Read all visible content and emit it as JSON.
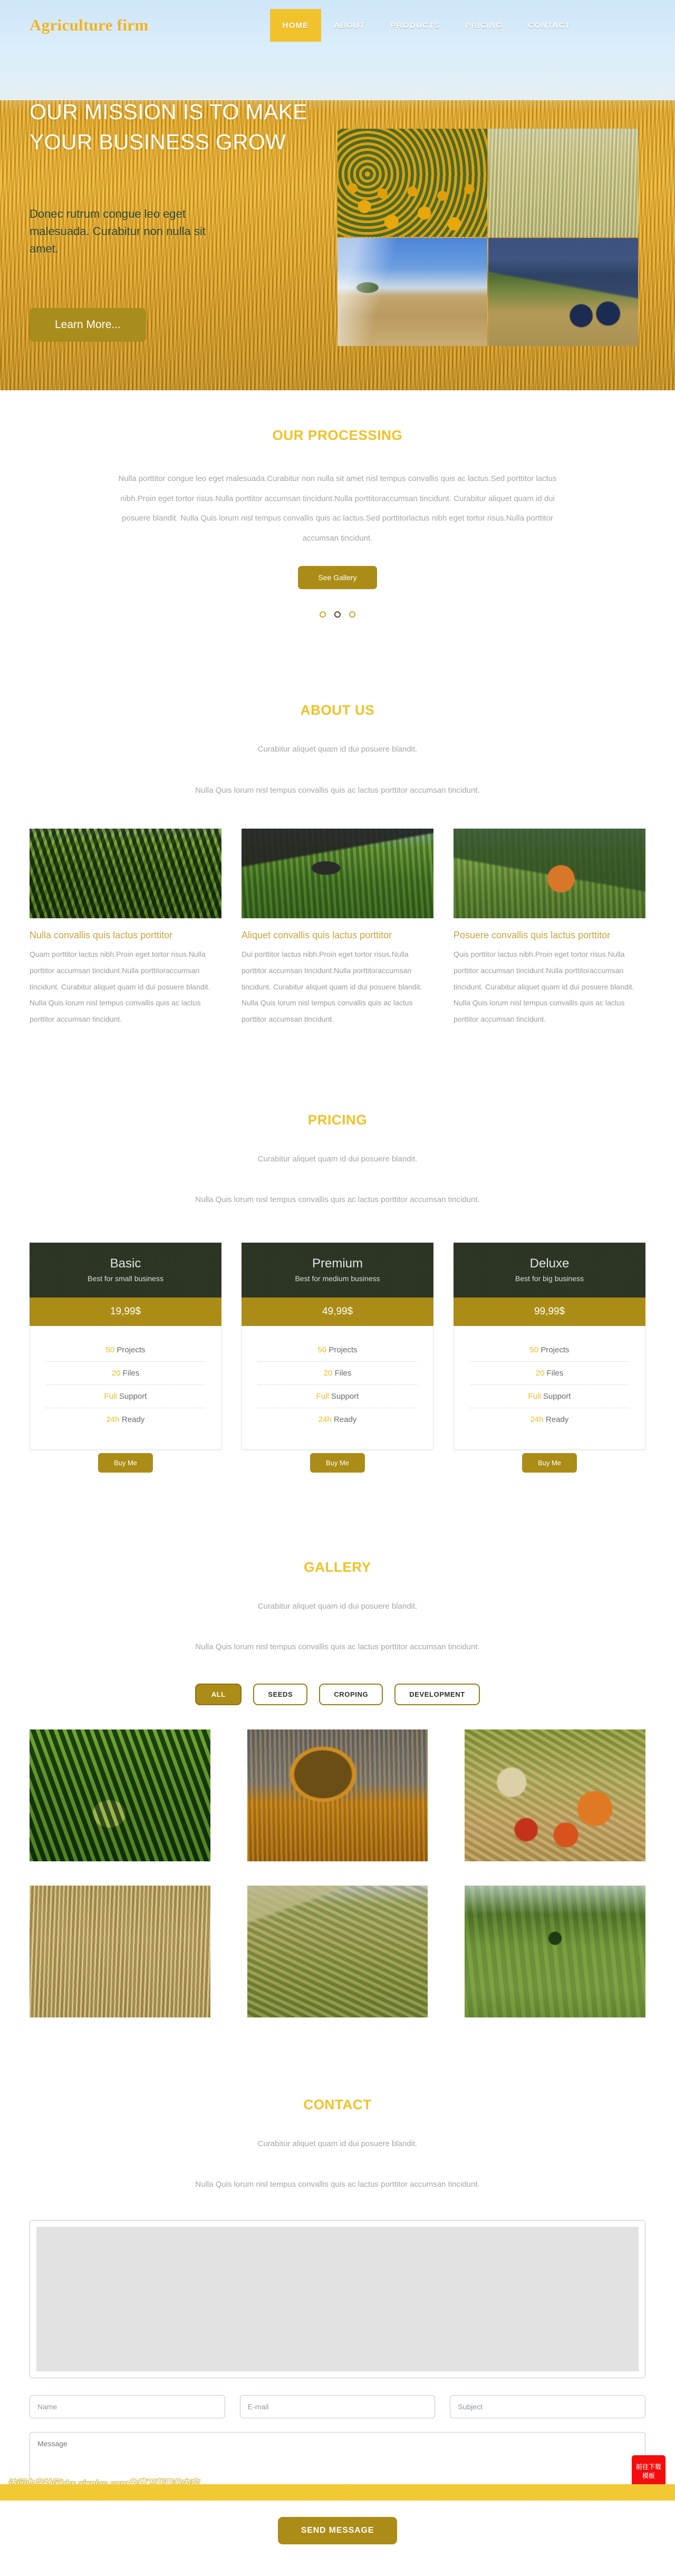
{
  "header": {
    "brand": "Agriculture firm",
    "nav": [
      {
        "label": "HOME",
        "active": true
      },
      {
        "label": "ABOUT",
        "active": false
      },
      {
        "label": "PRODUCTS",
        "active": false
      },
      {
        "label": "PRICING",
        "active": false
      },
      {
        "label": "CONTACT",
        "active": false
      }
    ]
  },
  "hero": {
    "title": "OUR MISSION IS TO MAKE YOUR BUSINESS GROW",
    "subtitle": "Donec rutrum congue leo eget malesuada. Curabitur non nulla sit amet.",
    "cta": "Learn More...",
    "collage": [
      "sunflower-field-photo",
      "wheat-closeup-photo",
      "harvester-field-photo",
      "tractor-trailer-photo"
    ]
  },
  "processing": {
    "title": "OUR PROCESSING",
    "lead": "Nulla porttitor congue leo eget malesuada.Curabitur non nulla sit amet nisl tempus convallis quis ac lactus.Sed porttitor lactus nibh.Proin eget tortor risus.Nulla porttitor accumsan tincidunt.Nulla porttitoraccumsan tincidunt. Curabitur aliquet quam id dui posuere blandit. Nulla Quis lorum nisl tempus convallis quis ac lactus.Sed porttitorlactus nibh eget tortor risus.Nulla porttitor accumsan tincidunt.",
    "button": "See Gallery",
    "dots": 3,
    "active_dot": 1
  },
  "about": {
    "title": "ABOUT US",
    "lead_line1": "Curabitur aliquet quam id dui posuere blandit.",
    "lead_line2": "Nulla Quis lorum nisl tempus convallis quis ac lactus porttitor accumsan tincidunt.",
    "cards": [
      {
        "image": "corn-field-photo",
        "title": "Nulla convallis quis lactus porttitor",
        "body": "Quam porttitor lactus nibh.Proin eget tortor risus.Nulla porttitor accumsan tincidunt.Nulla porttitoraccumsan tincidunt. Curabitur aliquet quam id dui posuere blandit. Nulla Quis lorum nisl tempus convallis quis ac lactus porttitor accumsan tincidunt."
      },
      {
        "image": "farmer-in-field-photo",
        "title": "Aliquet convallis quis lactus porttitor",
        "body": "Dui porttitor lactus nibh.Proin eget tortor risus.Nulla porttitor accumsan tincidunt.Nulla porttitoraccumsan tincidunt. Curabitur aliquet quam id dui posuere blandit. Nulla Quis lorum nisl tempus convallis quis ac lactus porttitor accumsan tincidunt."
      },
      {
        "image": "tractor-baling-photo",
        "title": "Posuere convallis quis lactus porttitor",
        "body": "Quis porttitor lactus nibh.Proin eget tortor risus.Nulla porttitor accumsan tincidunt.Nulla porttitoraccumsan tincidunt. Curabitur aliquet quam id dui posuere blandit. Nulla Quis lorum nisl tempus convallis quis ac lactus porttitor accumsan tincidunt."
      }
    ]
  },
  "pricing": {
    "title": "PRICING",
    "lead_line1": "Curabitur aliquet quam id dui posuere blandit.",
    "lead_line2": "Nulla Quis lorum nisl tempus convallis quis ac lactus porttitor accumsan tincidunt.",
    "plans": [
      {
        "name": "Basic",
        "tagline": "Best for small business",
        "price": "19,99$",
        "features": [
          {
            "value": "50",
            "label": "Projects"
          },
          {
            "value": "20",
            "label": "Files"
          },
          {
            "value": "Full",
            "label": "Support"
          },
          {
            "value": "24h",
            "label": "Ready"
          }
        ],
        "buy": "Buy Me"
      },
      {
        "name": "Premium",
        "tagline": "Best for medium business",
        "price": "49,99$",
        "features": [
          {
            "value": "50",
            "label": "Projects"
          },
          {
            "value": "20",
            "label": "Files"
          },
          {
            "value": "Full",
            "label": "Support"
          },
          {
            "value": "24h",
            "label": "Ready"
          }
        ],
        "buy": "Buy Me"
      },
      {
        "name": "Deluxe",
        "tagline": "Best for big business",
        "price": "99,99$",
        "features": [
          {
            "value": "50",
            "label": "Projects"
          },
          {
            "value": "20",
            "label": "Files"
          },
          {
            "value": "Full",
            "label": "Support"
          },
          {
            "value": "24h",
            "label": "Ready"
          }
        ],
        "buy": "Buy Me"
      }
    ]
  },
  "gallery": {
    "title": "GALLERY",
    "lead_line1": "Curabitur aliquet quam id dui posuere blandit.",
    "lead_line2": "Nulla Quis lorum nisl tempus convallis quis ac lactus porttitor accumsan tincidunt.",
    "filters": [
      {
        "label": "ALL",
        "active": true
      },
      {
        "label": "SEEDS",
        "active": false
      },
      {
        "label": "CROPING",
        "active": false
      },
      {
        "label": "DEVELOPMENT",
        "active": false
      }
    ],
    "tiles": [
      "squash-plants-photo",
      "hay-bale-photo",
      "vegetable-basket-photo",
      "wheat-ears-photo",
      "vineyard-hills-photo",
      "tractor-mowing-photo"
    ]
  },
  "contact": {
    "title": "CONTACT",
    "lead_line1": "Curabitur aliquet quam id dui posuere blandit.",
    "lead_line2": "Nulla Quis lorum nisl tempus convallis quis ac lactus porttitor accumsan tincidunt.",
    "map_placeholder": "map-embed",
    "fields": {
      "name_placeholder": "Name",
      "email_placeholder": "E-mail",
      "subject_placeholder": "Subject",
      "message_placeholder": "Message",
      "name_value": "",
      "email_value": "",
      "subject_value": "",
      "message_value": ""
    },
    "submit": "SEND MESSAGE"
  },
  "overlay": {
    "download_button": "前往下载模板",
    "watermark": "访问血鸟社区bbs.xienlao.com免费下载更多内容"
  },
  "colors": {
    "accent_yellow": "#f3c123",
    "gold": "#ab8c16",
    "dark_green": "#2b3323",
    "sky": "#cfe6f7",
    "red": "#f40d0d"
  }
}
